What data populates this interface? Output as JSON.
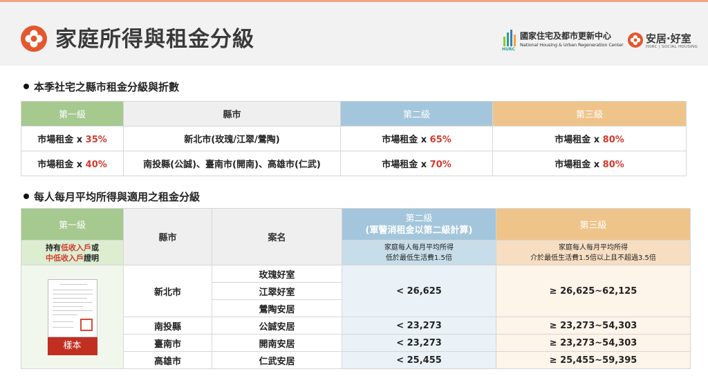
{
  "header": {
    "title": "家庭所得與租金分級",
    "hurc": {
      "name_cn": "國家住宅及都市更新中心",
      "name_en": "National Housing & Urban Regeneration Center",
      "abbr": "HURC"
    },
    "brand": {
      "name": "安居·好室",
      "sub": "HURC | SOCIAL HOUSING"
    },
    "colors": {
      "accent": "#e4572e",
      "green": "#a5c98e",
      "blue": "#a3c6dc",
      "orange": "#efc48a",
      "red": "#d23a2e"
    },
    "icons": [
      "flower-logo-icon",
      "hurc-logo-icon",
      "anju-logo-icon"
    ]
  },
  "section1": {
    "title": "本季社宅之縣市租金分級與折數",
    "headers": [
      "第一級",
      "縣市",
      "第二級",
      "第三級"
    ],
    "rows": [
      {
        "tier1_prefix": "市場租金 x ",
        "tier1_pct": "35%",
        "city": "新北市(玫瑰/江翠/鶯陶)",
        "tier2_prefix": "市場租金 x ",
        "tier2_pct": "65%",
        "tier3_prefix": "市場租金 x ",
        "tier3_pct": "80%"
      },
      {
        "tier1_prefix": "市場租金 x ",
        "tier1_pct": "40%",
        "city": "南投縣(公誠)、臺南市(開南)、高雄市(仁武)",
        "tier2_prefix": "市場租金 x ",
        "tier2_pct": "70%",
        "tier3_prefix": "市場租金 x ",
        "tier3_pct": "80%"
      }
    ]
  },
  "section2": {
    "title": "每人每月平均所得與適用之租金分級",
    "headers": {
      "tier1": "第一級",
      "city": "縣市",
      "project": "案名",
      "tier2_line1": "第二級",
      "tier2_line2": "(軍警消租金以第二級計算)",
      "tier3": "第三級"
    },
    "subheaders": {
      "tier1_a": "持有",
      "tier1_b": "低收入戶",
      "tier1_c": "或",
      "tier1_d": "中低收入戶",
      "tier1_e": "證明",
      "tier2_a": "家庭每人每月平均所得",
      "tier2_b": "低於最低生活費1.5倍",
      "tier3_a": "家庭每人每月平均所得",
      "tier3_b": "介於最低生活費1.5倍以上且不超過3.5倍"
    },
    "sample_label": "樣本",
    "rows": {
      "newtaipei": {
        "city": "新北市",
        "projects": [
          "玫瑰好室",
          "江翠好室",
          "鶯陶安居"
        ],
        "tier2": "< 26,625",
        "tier3": "≥ 26,625~62,125"
      },
      "nantou": {
        "city": "南投縣",
        "project": "公誠安居",
        "tier2": "< 23,273",
        "tier3": "≥ 23,273~54,303"
      },
      "tainan": {
        "city": "臺南市",
        "project": "開南安居",
        "tier2": "< 23,273",
        "tier3": "≥ 23,273~54,303"
      },
      "kaohsiung": {
        "city": "高雄市",
        "project": "仁武安居",
        "tier2": "< 25,455",
        "tier3": "≥ 25,455~59,395"
      }
    }
  }
}
